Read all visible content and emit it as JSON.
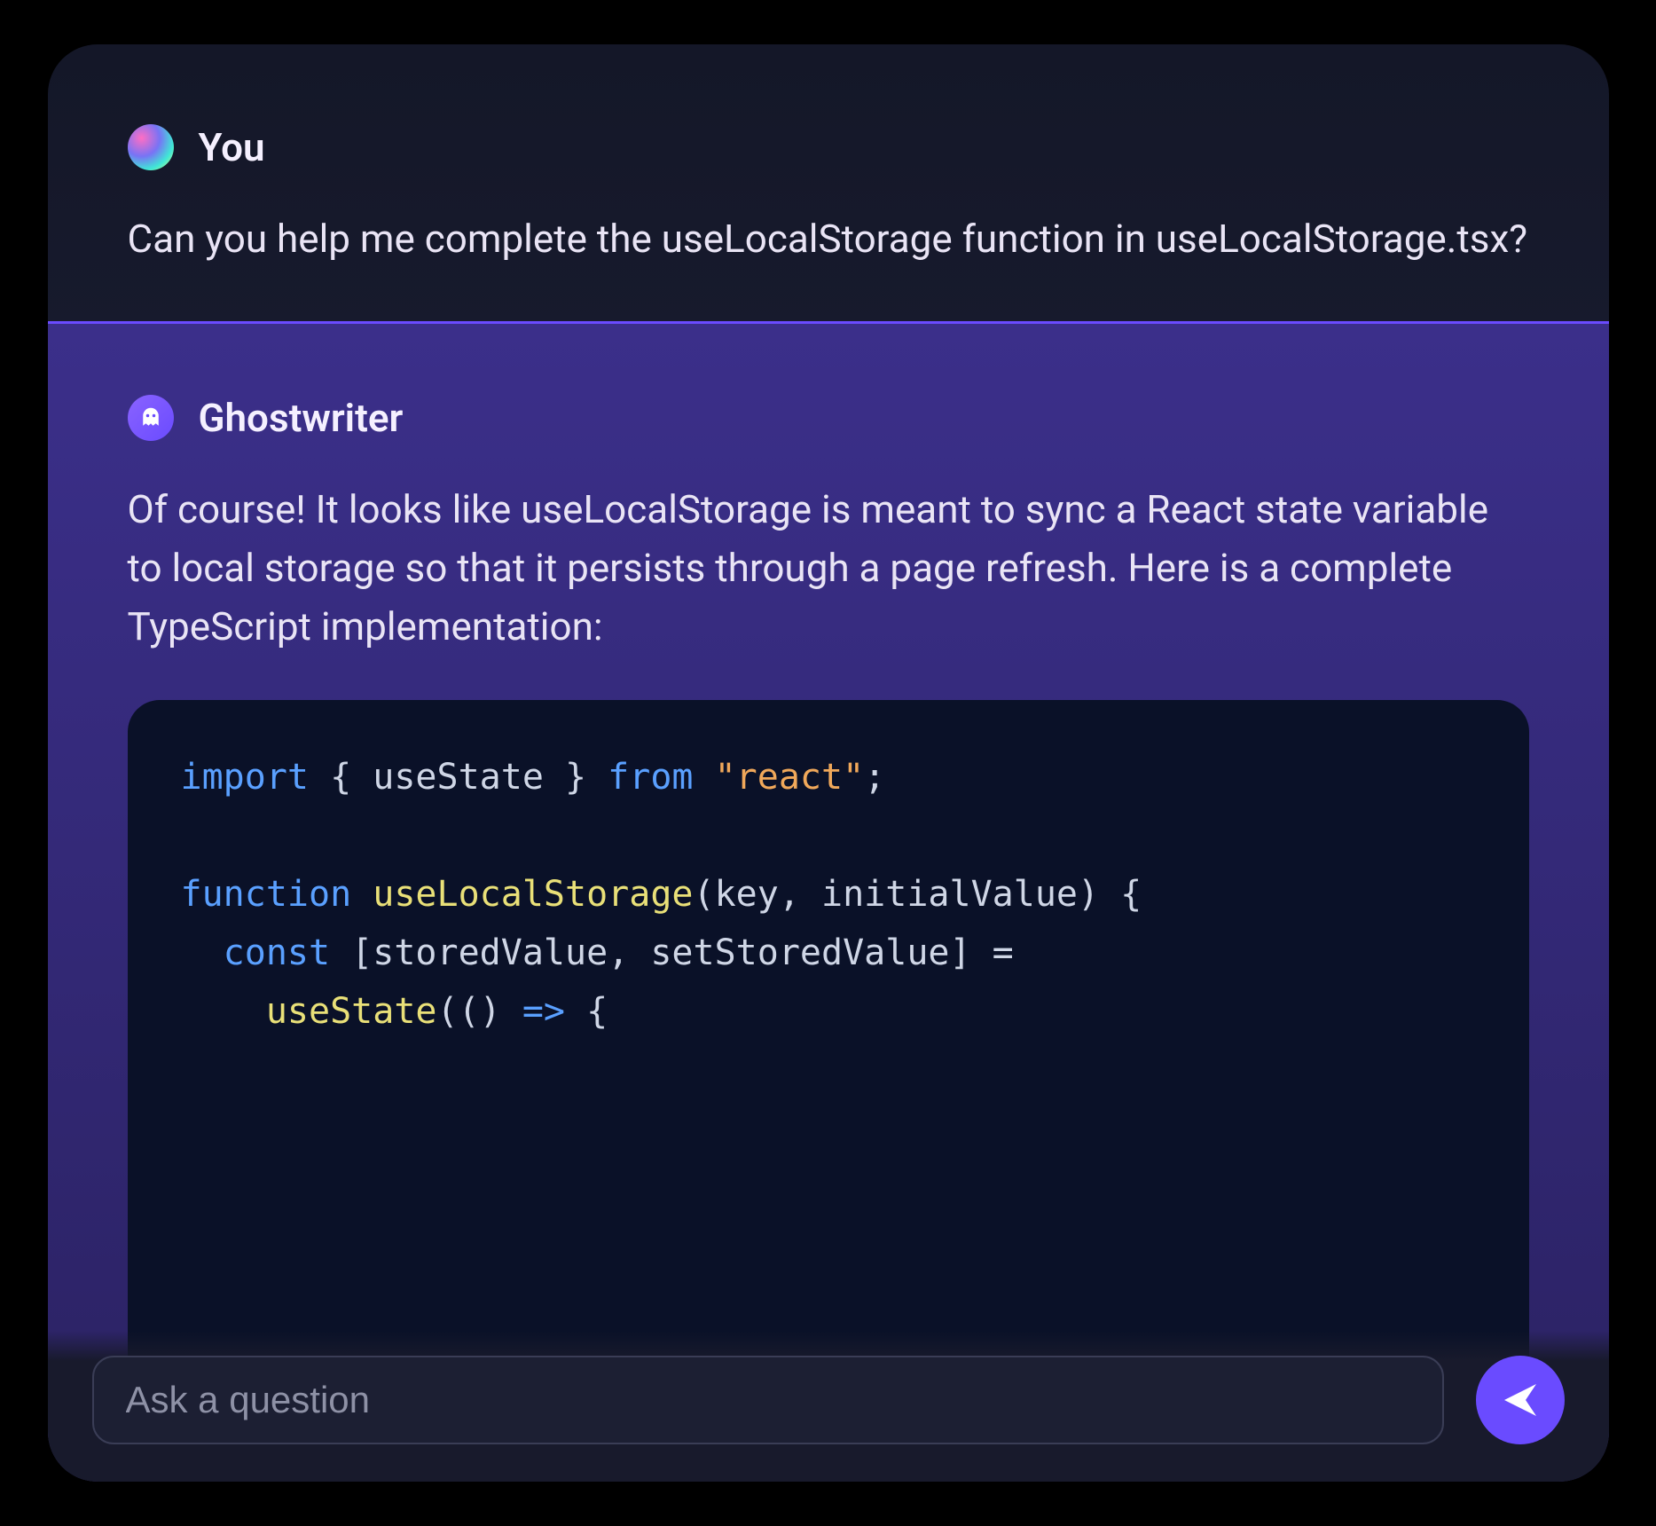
{
  "user": {
    "name": "You",
    "message": "Can you help me complete the useLocalStorage function in useLocalStorage.tsx?"
  },
  "bot": {
    "name": "Ghostwriter",
    "icon": "ghost-icon",
    "message": "Of course! It looks like useLocalStorage is meant to sync a React state variable to local storage so that it persists through a page refresh. Here is a complete TypeScript implementation:",
    "code": {
      "tokens": [
        {
          "t": "import",
          "c": "kw"
        },
        {
          "t": " { ",
          "c": "pn"
        },
        {
          "t": "useState",
          "c": "id"
        },
        {
          "t": " } ",
          "c": "pn"
        },
        {
          "t": "from",
          "c": "kw"
        },
        {
          "t": " ",
          "c": "pn"
        },
        {
          "t": "\"react\"",
          "c": "str"
        },
        {
          "t": ";",
          "c": "pn"
        },
        {
          "t": "\n\n",
          "c": "pn"
        },
        {
          "t": "function",
          "c": "kw"
        },
        {
          "t": " ",
          "c": "pn"
        },
        {
          "t": "useLocalStorage",
          "c": "fn"
        },
        {
          "t": "(",
          "c": "pn"
        },
        {
          "t": "key",
          "c": "id"
        },
        {
          "t": ", ",
          "c": "pn"
        },
        {
          "t": "initialValue",
          "c": "id"
        },
        {
          "t": ") {",
          "c": "pn"
        },
        {
          "t": "\n  ",
          "c": "pn"
        },
        {
          "t": "const",
          "c": "kw"
        },
        {
          "t": " [",
          "c": "pn"
        },
        {
          "t": "storedValue",
          "c": "id"
        },
        {
          "t": ", ",
          "c": "pn"
        },
        {
          "t": "setStoredValue",
          "c": "id"
        },
        {
          "t": "] =",
          "c": "pn"
        },
        {
          "t": "\n    ",
          "c": "pn"
        },
        {
          "t": "useState",
          "c": "fn"
        },
        {
          "t": "(() ",
          "c": "pn"
        },
        {
          "t": "=>",
          "c": "kw"
        },
        {
          "t": " {",
          "c": "pn"
        }
      ]
    }
  },
  "input": {
    "placeholder": "Ask a question",
    "value": ""
  },
  "colors": {
    "accent": "#6a4bff",
    "code_bg": "#0a1128",
    "bot_bg_top": "#3b2f8a"
  }
}
